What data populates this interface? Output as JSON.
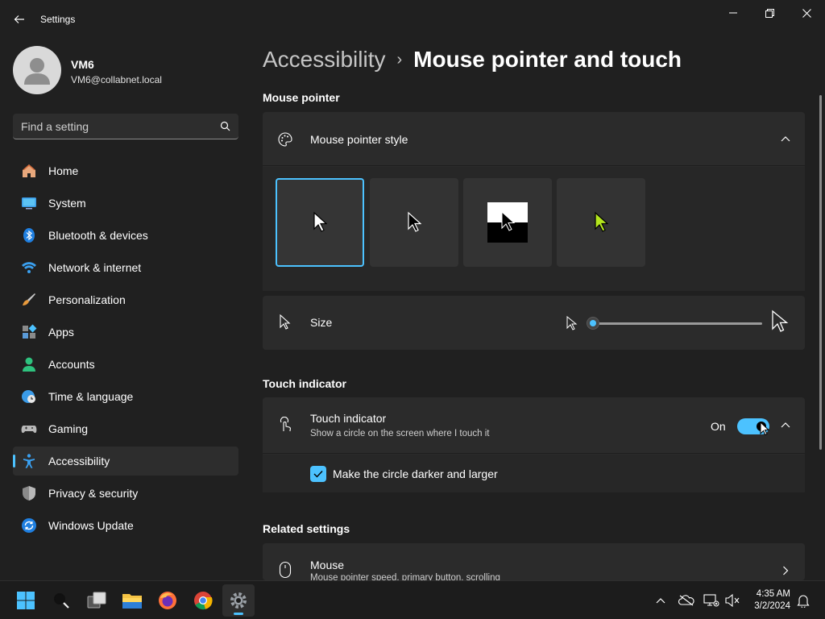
{
  "window": {
    "title": "Settings"
  },
  "user": {
    "name": "VM6",
    "email": "VM6@collabnet.local"
  },
  "search": {
    "placeholder": "Find a setting"
  },
  "sidebar": {
    "items": [
      {
        "label": "Home",
        "icon": "home-icon",
        "active": false
      },
      {
        "label": "System",
        "icon": "system-icon",
        "active": false
      },
      {
        "label": "Bluetooth & devices",
        "icon": "bluetooth-icon",
        "active": false
      },
      {
        "label": "Network & internet",
        "icon": "wifi-icon",
        "active": false
      },
      {
        "label": "Personalization",
        "icon": "brush-icon",
        "active": false
      },
      {
        "label": "Apps",
        "icon": "apps-icon",
        "active": false
      },
      {
        "label": "Accounts",
        "icon": "accounts-icon",
        "active": false
      },
      {
        "label": "Time & language",
        "icon": "clock-globe-icon",
        "active": false
      },
      {
        "label": "Gaming",
        "icon": "gamepad-icon",
        "active": false
      },
      {
        "label": "Accessibility",
        "icon": "accessibility-icon",
        "active": true
      },
      {
        "label": "Privacy & security",
        "icon": "shield-icon",
        "active": false
      },
      {
        "label": "Windows Update",
        "icon": "update-icon",
        "active": false
      }
    ]
  },
  "breadcrumb": {
    "parent": "Accessibility",
    "separator": "›",
    "current": "Mouse pointer and touch"
  },
  "mouse_pointer": {
    "section_title": "Mouse pointer",
    "style_label": "Mouse pointer style",
    "styles": [
      "white",
      "black",
      "inverted",
      "custom"
    ],
    "selected_style": "white",
    "custom_color": "#b4e61e",
    "size_label": "Size",
    "size_value": 1,
    "size_max": 15
  },
  "touch_indicator": {
    "section_title": "Touch indicator",
    "label": "Touch indicator",
    "description": "Show a circle on the screen where I touch it",
    "toggle_state": "On",
    "checkbox_label": "Make the circle darker and larger",
    "checkbox_checked": true
  },
  "related": {
    "section_title": "Related settings",
    "mouse_label": "Mouse",
    "mouse_description": "Mouse pointer speed, primary button, scrolling"
  },
  "taskbar": {
    "apps": [
      "start-icon",
      "search-icon",
      "task-view-icon",
      "file-explorer-icon",
      "firefox-icon",
      "chrome-icon",
      "settings-icon"
    ],
    "time": "4:35 AM",
    "date": "3/2/2024"
  },
  "colors": {
    "accent": "#4cc2ff",
    "background": "#202020",
    "card": "#2b2b2b"
  }
}
